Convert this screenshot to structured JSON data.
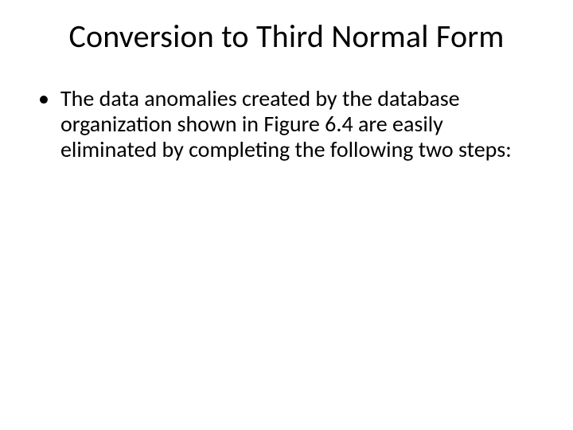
{
  "slide": {
    "title": "Conversion to Third Normal Form",
    "bullets": [
      "The data anomalies created by the database organization shown in Figure 6.4 are easily eliminated by completing the following two steps:"
    ]
  }
}
